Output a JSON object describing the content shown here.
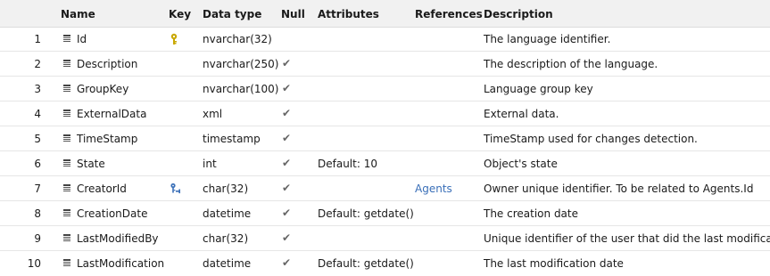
{
  "columns": {
    "name": "Name",
    "key": "Key",
    "data_type": "Data type",
    "null": "Null",
    "attributes": "Attributes",
    "references": "References",
    "description": "Description"
  },
  "rows": [
    {
      "num": "1",
      "name": "Id",
      "key": "primary-key-icon",
      "type": "nvarchar(32)",
      "null": false,
      "attributes": "",
      "references": "",
      "description": "The language identifier."
    },
    {
      "num": "2",
      "name": "Description",
      "key": "",
      "type": "nvarchar(250)",
      "null": true,
      "attributes": "",
      "references": "",
      "description": "The description of the language."
    },
    {
      "num": "3",
      "name": "GroupKey",
      "key": "",
      "type": "nvarchar(100)",
      "null": true,
      "attributes": "",
      "references": "",
      "description": "Language group key"
    },
    {
      "num": "4",
      "name": "ExternalData",
      "key": "",
      "type": "xml",
      "null": true,
      "attributes": "",
      "references": "",
      "description": "External data."
    },
    {
      "num": "5",
      "name": "TimeStamp",
      "key": "",
      "type": "timestamp",
      "null": true,
      "attributes": "",
      "references": "",
      "description": "TimeStamp used for changes detection."
    },
    {
      "num": "6",
      "name": "State",
      "key": "",
      "type": "int",
      "null": true,
      "attributes": "Default: 10",
      "references": "",
      "description": "Object's state"
    },
    {
      "num": "7",
      "name": "CreatorId",
      "key": "foreign-key-icon",
      "type": "char(32)",
      "null": true,
      "attributes": "",
      "references": "Agents",
      "description": "Owner unique identifier. To be related to Agents.Id"
    },
    {
      "num": "8",
      "name": "CreationDate",
      "key": "",
      "type": "datetime",
      "null": true,
      "attributes": "Default: getdate()",
      "references": "",
      "description": "The creation date"
    },
    {
      "num": "9",
      "name": "LastModifiedBy",
      "key": "",
      "type": "char(32)",
      "null": true,
      "attributes": "",
      "references": "",
      "description": "Unique identifier of the user that did the last modifications"
    },
    {
      "num": "10",
      "name": "LastModification",
      "key": "",
      "type": "datetime",
      "null": true,
      "attributes": "Default: getdate()",
      "references": "",
      "description": "The last modification date"
    }
  ],
  "colors": {
    "header_bg": "#f1f1f1",
    "link": "#3a6fb8",
    "primary_key": "#c9a800",
    "foreign_key": "#3a6fb8",
    "check": "#666666"
  }
}
